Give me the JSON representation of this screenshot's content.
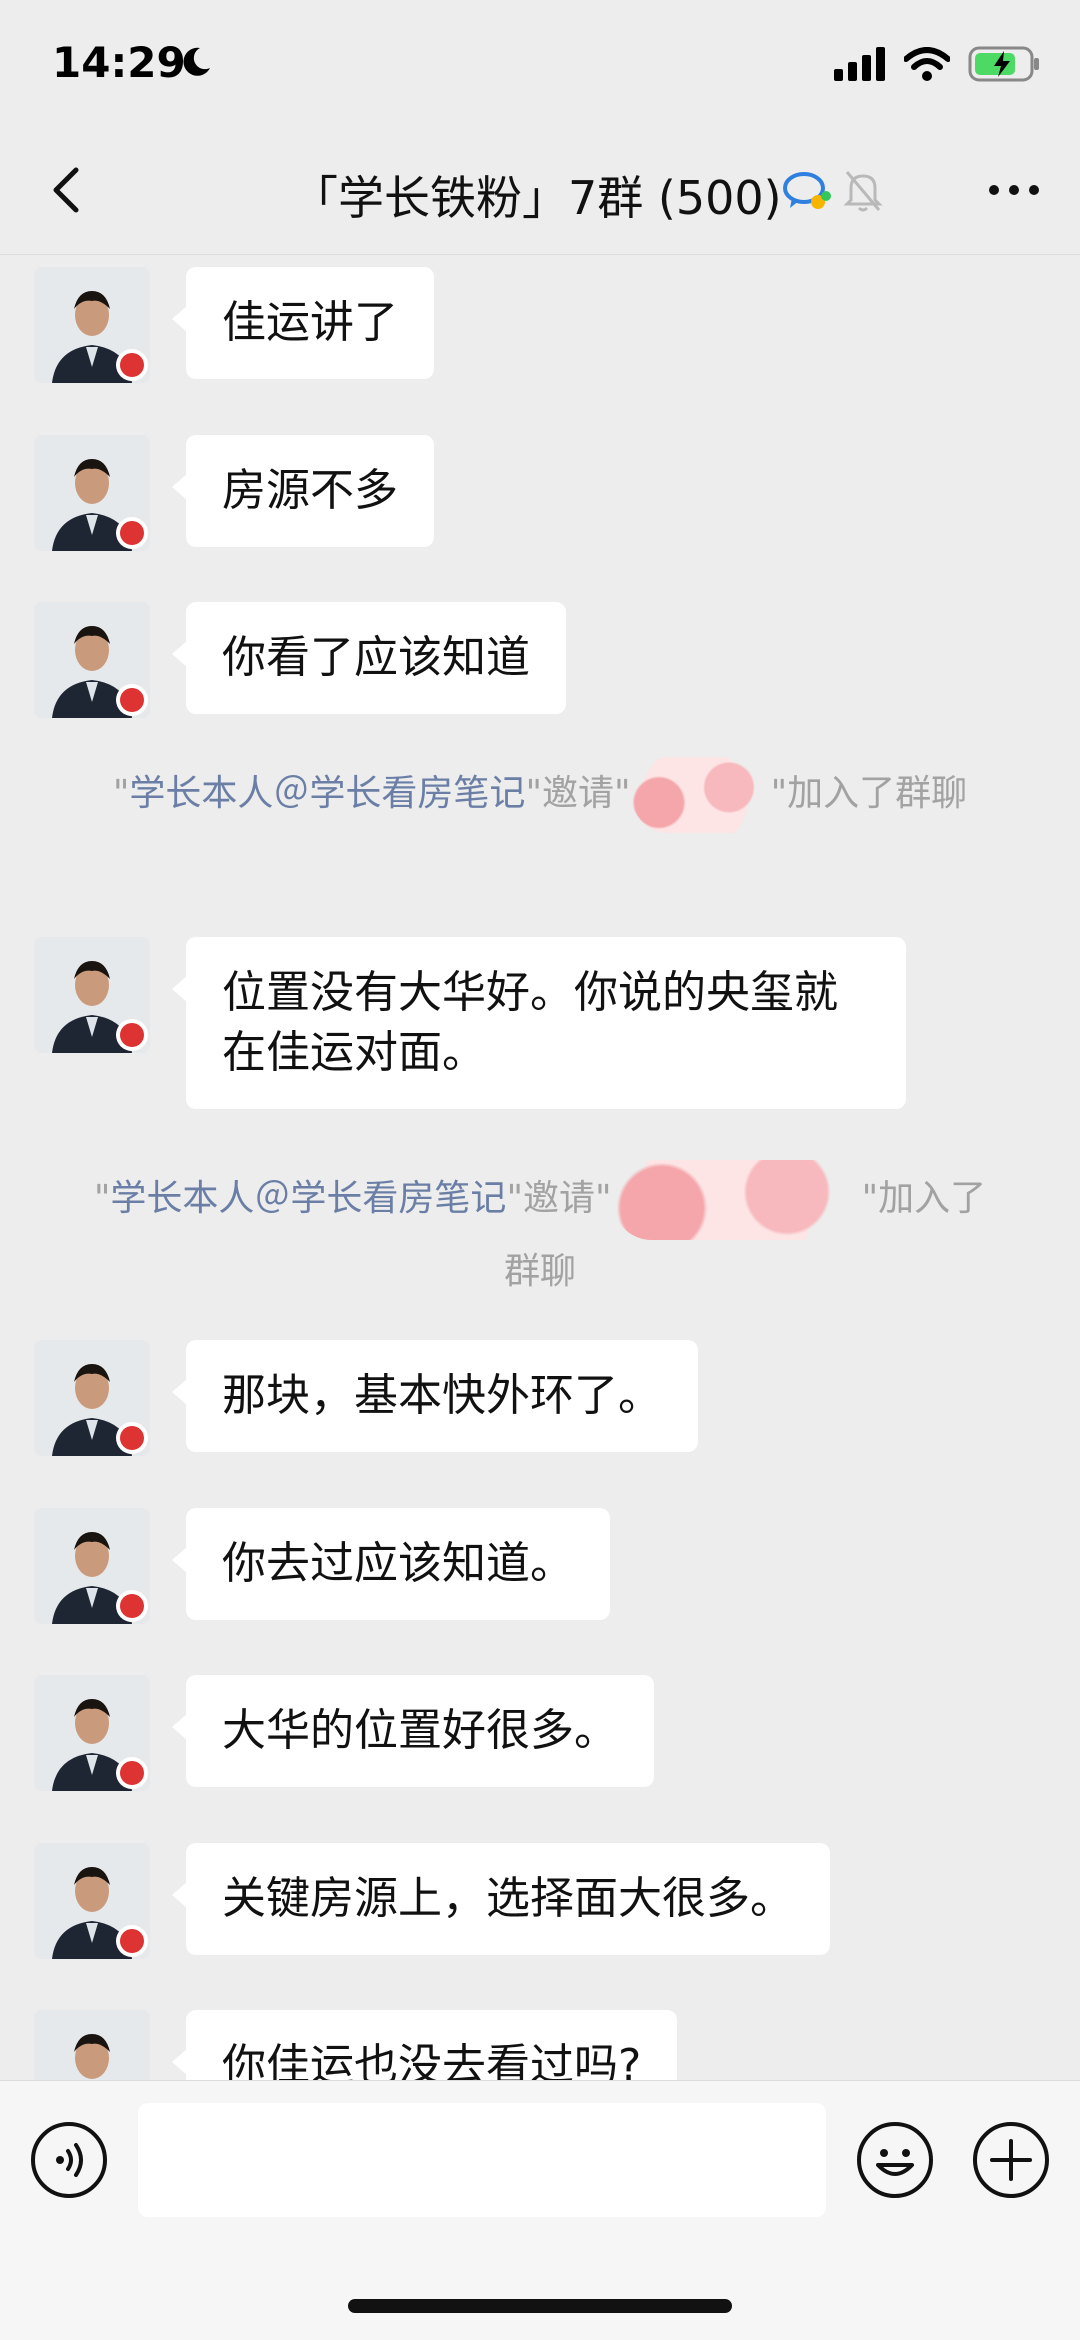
{
  "status": {
    "time": "14:29"
  },
  "header": {
    "title": "「学长铁粉」7群 (500)"
  },
  "messages": [
    {
      "text": "佳运讲了"
    },
    {
      "text": "房源不多"
    },
    {
      "text": "你看了应该知道"
    },
    {
      "text": "位置没有大华好。你说的央玺就在佳运对面。"
    },
    {
      "text": "那块，基本快外环了。"
    },
    {
      "text": "你去过应该知道。"
    },
    {
      "text": "大华的位置好很多。"
    },
    {
      "text": "关键房源上，选择面大很多。"
    },
    {
      "text": "你佳运也没去看过吗?"
    }
  ],
  "system": [
    {
      "quote_open": "\"",
      "mention": "学长本人＠学长看房笔记",
      "invite": "\"邀请\"",
      "tail": "\"加入了群聊"
    },
    {
      "quote_open": "\"",
      "mention": "学长本人＠学长看房笔记",
      "invite": "\"邀请\"",
      "tail": "\"加入了群聊"
    }
  ],
  "input": {
    "placeholder": ""
  },
  "colors": {
    "background": "#ededed",
    "bubble": "#ffffff",
    "mention": "#6b7fa6",
    "system_text": "#a2a2a2",
    "battery": "#4cd964"
  }
}
